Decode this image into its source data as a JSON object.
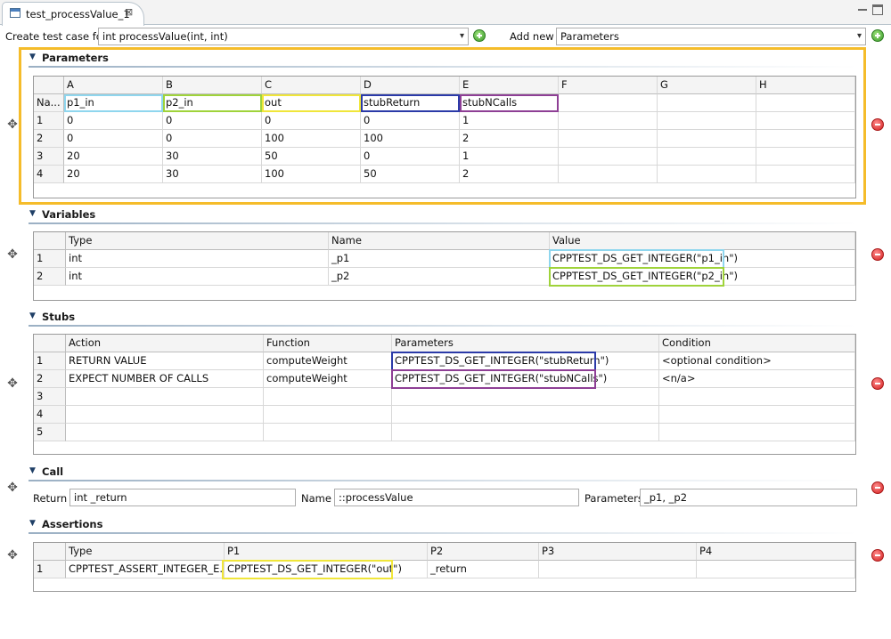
{
  "tab": {
    "title": "test_processValue_1",
    "close_glyph": "⊠"
  },
  "create_row": {
    "label": "Create test case for",
    "function_value": "int processValue(int, int)",
    "add_new_label": "Add new",
    "add_new_value": "Parameters"
  },
  "parameters": {
    "title": "Parameters",
    "columns": [
      "A",
      "B",
      "C",
      "D",
      "E",
      "F",
      "G",
      "H"
    ],
    "name_row_header": "Na...",
    "names": [
      "p1_in",
      "p2_in",
      "out",
      "stubReturn",
      "stubNCalls",
      "",
      "",
      ""
    ],
    "rows": [
      {
        "num": "1",
        "cells": [
          "0",
          "0",
          "0",
          "0",
          "1",
          "",
          "",
          ""
        ]
      },
      {
        "num": "2",
        "cells": [
          "0",
          "0",
          "100",
          "100",
          "2",
          "",
          "",
          ""
        ]
      },
      {
        "num": "3",
        "cells": [
          "20",
          "30",
          "50",
          "0",
          "1",
          "",
          "",
          ""
        ]
      },
      {
        "num": "4",
        "cells": [
          "20",
          "30",
          "100",
          "50",
          "2",
          "",
          "",
          ""
        ]
      }
    ]
  },
  "variables": {
    "title": "Variables",
    "columns": [
      "Type",
      "Name",
      "Value"
    ],
    "rows": [
      {
        "num": "1",
        "cells": [
          "int",
          "_p1",
          "CPPTEST_DS_GET_INTEGER(\"p1_in\")"
        ]
      },
      {
        "num": "2",
        "cells": [
          "int",
          "_p2",
          "CPPTEST_DS_GET_INTEGER(\"p2_in\")"
        ]
      }
    ]
  },
  "stubs": {
    "title": "Stubs",
    "columns": [
      "Action",
      "Function",
      "Parameters",
      "Condition"
    ],
    "rows": [
      {
        "num": "1",
        "cells": [
          "RETURN VALUE",
          "computeWeight",
          "CPPTEST_DS_GET_INTEGER(\"stubReturn\")",
          "<optional condition>"
        ]
      },
      {
        "num": "2",
        "cells": [
          "EXPECT NUMBER OF CALLS",
          "computeWeight",
          "CPPTEST_DS_GET_INTEGER(\"stubNCalls\")",
          "<n/a>"
        ]
      },
      {
        "num": "3",
        "cells": [
          "",
          "",
          "",
          ""
        ]
      },
      {
        "num": "4",
        "cells": [
          "",
          "",
          "",
          ""
        ]
      },
      {
        "num": "5",
        "cells": [
          "",
          "",
          "",
          ""
        ]
      }
    ]
  },
  "call": {
    "title": "Call",
    "return_label": "Return",
    "return_value": "int _return",
    "name_label": "Name",
    "name_value": "::processValue",
    "params_label": "Parameters",
    "params_value": "_p1, _p2"
  },
  "assertions": {
    "title": "Assertions",
    "columns": [
      "Type",
      "P1",
      "P2",
      "P3",
      "P4"
    ],
    "rows": [
      {
        "num": "1",
        "cells": [
          "CPPTEST_ASSERT_INTEGER_E...",
          "CPPTEST_DS_GET_INTEGER(\"out\")",
          "_return",
          "",
          ""
        ]
      }
    ]
  },
  "colors": {
    "params_frame": "#f5bc2a",
    "hl_light_blue": "#8fd6ee",
    "hl_green": "#9fd33a",
    "hl_yellow": "#f0e63a",
    "hl_dark_blue": "#2b3aa8",
    "hl_purple": "#8e3f95"
  },
  "icons": {
    "move": "move-icon",
    "add": "add-icon",
    "remove": "remove-icon",
    "collapse": "triangle-down-icon"
  }
}
